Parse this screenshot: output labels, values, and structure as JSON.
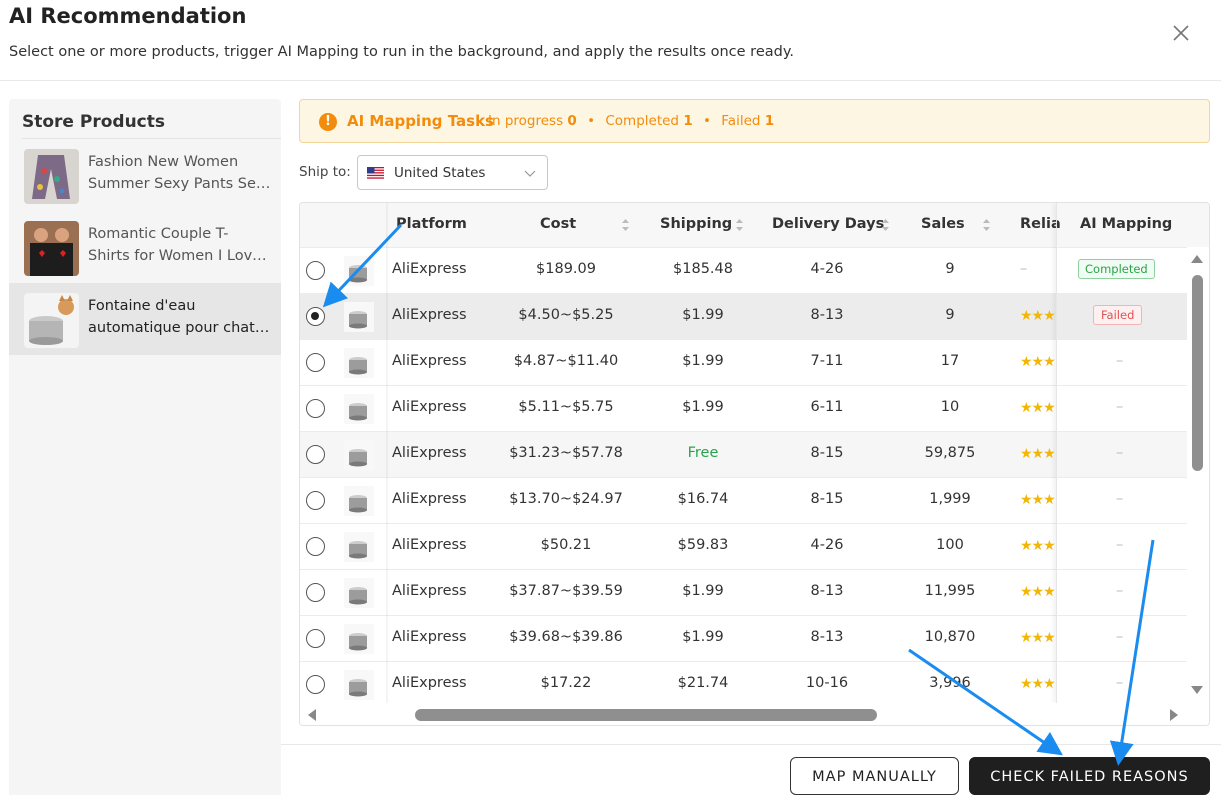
{
  "modal": {
    "title": "AI Recommendation",
    "subtitle": "Select one or more products, trigger AI Mapping to run in the background, and apply the results once ready."
  },
  "sidebar": {
    "title": "Store Products",
    "items": [
      {
        "line1": "Fashion New Women",
        "line2": "Summer Sexy Pants Se…"
      },
      {
        "line1": "Romantic Couple T-",
        "line2": "Shirts for Women I Lov…"
      },
      {
        "line1": "Fontaine d'eau",
        "line2": "automatique pour chat…"
      }
    ]
  },
  "tasks": {
    "title": "AI Mapping Tasks",
    "in_progress_label": "In progress",
    "in_progress": "0",
    "completed_label": "Completed",
    "completed": "1",
    "failed_label": "Failed",
    "failed": "1",
    "separator": "•"
  },
  "ship": {
    "label": "Ship to:",
    "value": "United States"
  },
  "table": {
    "columns": {
      "platform": "Platform",
      "cost": "Cost",
      "shipping": "Shipping",
      "delivery": "Delivery Days",
      "sales": "Sales",
      "reliability": "Relia",
      "ai_mapping": "AI Mapping"
    },
    "rows": [
      {
        "platform": "AliExpress",
        "cost": "$189.09",
        "shipping": "$185.48",
        "delivery": "4-26",
        "sales": "9",
        "reliability": "–",
        "stars": "",
        "ai": "Completed",
        "ai_status": "completed"
      },
      {
        "platform": "AliExpress",
        "cost": "$4.50~$5.25",
        "shipping": "$1.99",
        "delivery": "8-13",
        "sales": "9",
        "reliability": "",
        "stars": "★★★",
        "ai": "Failed",
        "ai_status": "failed"
      },
      {
        "platform": "AliExpress",
        "cost": "$4.87~$11.40",
        "shipping": "$1.99",
        "delivery": "7-11",
        "sales": "17",
        "reliability": "",
        "stars": "★★★",
        "ai": "–",
        "ai_status": "none"
      },
      {
        "platform": "AliExpress",
        "cost": "$5.11~$5.75",
        "shipping": "$1.99",
        "delivery": "6-11",
        "sales": "10",
        "reliability": "",
        "stars": "★★★",
        "ai": "–",
        "ai_status": "none"
      },
      {
        "platform": "AliExpress",
        "cost": "$31.23~$57.78",
        "shipping": "Free",
        "delivery": "8-15",
        "sales": "59,875",
        "reliability": "",
        "stars": "★★★",
        "ai": "–",
        "ai_status": "none"
      },
      {
        "platform": "AliExpress",
        "cost": "$13.70~$24.97",
        "shipping": "$16.74",
        "delivery": "8-15",
        "sales": "1,999",
        "reliability": "",
        "stars": "★★★",
        "ai": "–",
        "ai_status": "none"
      },
      {
        "platform": "AliExpress",
        "cost": "$50.21",
        "shipping": "$59.83",
        "delivery": "4-26",
        "sales": "100",
        "reliability": "",
        "stars": "★★★",
        "ai": "–",
        "ai_status": "none"
      },
      {
        "platform": "AliExpress",
        "cost": "$37.87~$39.59",
        "shipping": "$1.99",
        "delivery": "8-13",
        "sales": "11,995",
        "reliability": "",
        "stars": "★★★",
        "ai": "–",
        "ai_status": "none"
      },
      {
        "platform": "AliExpress",
        "cost": "$39.68~$39.86",
        "shipping": "$1.99",
        "delivery": "8-13",
        "sales": "10,870",
        "reliability": "",
        "stars": "★★★",
        "ai": "–",
        "ai_status": "none"
      },
      {
        "platform": "AliExpress",
        "cost": "$17.22",
        "shipping": "$21.74",
        "delivery": "10-16",
        "sales": "3,996",
        "reliability": "",
        "stars": "★★★",
        "ai": "–",
        "ai_status": "none"
      }
    ]
  },
  "footer": {
    "map_manually": "MAP MANUALLY",
    "check_failed": "CHECK FAILED REASONS"
  },
  "colors": {
    "accent": "#f28c0c",
    "free": "#2aa44a",
    "failed": "#e05252",
    "annotation": "#1a8cf0"
  }
}
